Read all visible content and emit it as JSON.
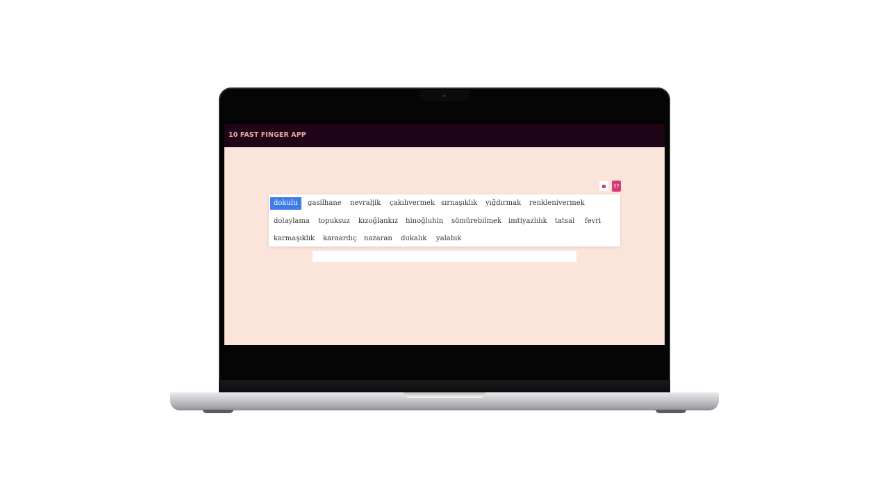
{
  "app": {
    "title": "10 FAST FINGER APP"
  },
  "timer": {
    "seconds": "57"
  },
  "typing_field": {
    "value": "",
    "placeholder": ""
  },
  "words": {
    "line1": [
      "dokulu",
      "gasilhane",
      "nevraljik",
      "çakılıvermek",
      "sırnaşıklık",
      "yığdırmak",
      "renklenivermek"
    ],
    "line2": [
      "dolaylama",
      "topuksuz",
      "kızoğlankız",
      "hinoğluhin",
      "sömürebilmek",
      "imtiyazlılık",
      "tatsal",
      "fevri"
    ],
    "line3": [
      "karmaşıklık",
      "karaardıç",
      "nazaran",
      "dukalık",
      "yalabık"
    ]
  },
  "current_word": "dokulu",
  "colors": {
    "screen_background": "#fbe4da",
    "header_background": "#1f0517",
    "header_text": "#e7a8a0",
    "accent_pink": "#d63a78",
    "current_word_highlight": "#3d7de8"
  },
  "icons": {
    "stop": "stop-square-icon"
  }
}
